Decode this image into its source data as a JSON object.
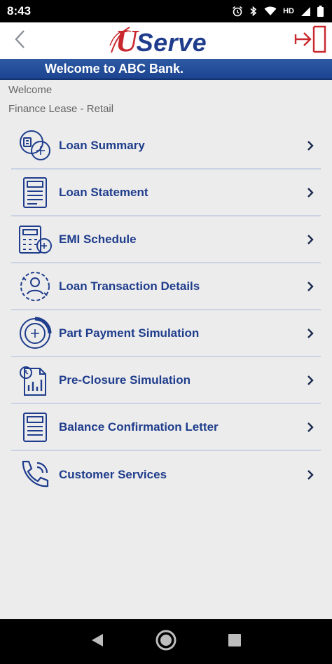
{
  "status_bar": {
    "time": "8:43",
    "network_label": "HD",
    "icons": [
      "alarm-icon",
      "bluetooth-icon",
      "wifi-icon",
      "signal-icon",
      "battery-icon"
    ]
  },
  "header": {
    "back_icon": "chevron-left-icon",
    "logo_prefix": "U",
    "logo_text": "Serve",
    "logout_icon": "logout-icon"
  },
  "banner": {
    "text": "Welcome to ABC Bank."
  },
  "info": {
    "greeting": "Welcome",
    "product": "Finance Lease - Retail"
  },
  "menu": {
    "items": [
      {
        "label": "Loan Summary",
        "icon": "loan-summary-icon"
      },
      {
        "label": "Loan Statement",
        "icon": "document-icon"
      },
      {
        "label": "EMI Schedule",
        "icon": "calculator-icon"
      },
      {
        "label": "Loan Transaction Details",
        "icon": "transaction-icon"
      },
      {
        "label": "Part Payment Simulation",
        "icon": "payment-icon"
      },
      {
        "label": "Pre-Closure Simulation",
        "icon": "simulation-icon"
      },
      {
        "label": "Balance Confirmation Letter",
        "icon": "letter-icon"
      },
      {
        "label": "Customer Services",
        "icon": "phone-icon"
      }
    ]
  },
  "colors": {
    "brand_blue": "#1f3d8c",
    "brand_red": "#c8282e",
    "banner_blue": "#2d5aa3"
  },
  "nav_bar": {
    "icons": [
      "back-triangle-icon",
      "home-circle-icon",
      "recents-square-icon"
    ]
  }
}
